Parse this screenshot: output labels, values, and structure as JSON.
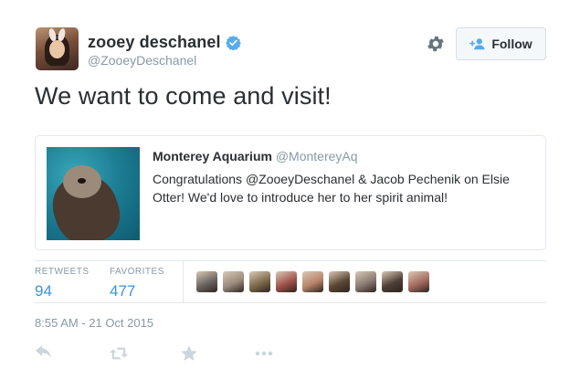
{
  "tweet": {
    "author": {
      "name": "zooey deschanel",
      "handle": "@ZooeyDeschanel",
      "verified": true
    },
    "follow_label": "Follow",
    "text": "We want to come and visit!",
    "quoted": {
      "name": "Monterey Aquarium",
      "handle": "@MontereyAq",
      "text": "Congratulations @ZooeyDeschanel & Jacob Pechenik on Elsie Otter! We'd love to introduce her to her spirit animal!"
    },
    "stats": {
      "retweets_label": "RETWEETS",
      "retweets_value": "94",
      "favorites_label": "FAVORITES",
      "favorites_value": "477"
    },
    "favoriter_avatars": [
      {
        "color": "#6b6460"
      },
      {
        "color": "#9a8b7c"
      },
      {
        "color": "#7d6a4a"
      },
      {
        "color": "#a0524a"
      },
      {
        "color": "#b8846a"
      },
      {
        "color": "#5c4636"
      },
      {
        "color": "#8a7a72"
      },
      {
        "color": "#4e3f37"
      },
      {
        "color": "#a46a5e"
      }
    ],
    "timestamp": "8:55 AM - 21 Oct 2015",
    "actions": [
      "reply-icon",
      "retweet-icon",
      "favorite-icon",
      "more-icon"
    ]
  },
  "colors": {
    "text": "#292f33",
    "muted": "#8899a6",
    "link": "#3b94d9",
    "verified": "#55acee",
    "border": "#e1e8ed",
    "action_icon": "#ccd6dd"
  }
}
